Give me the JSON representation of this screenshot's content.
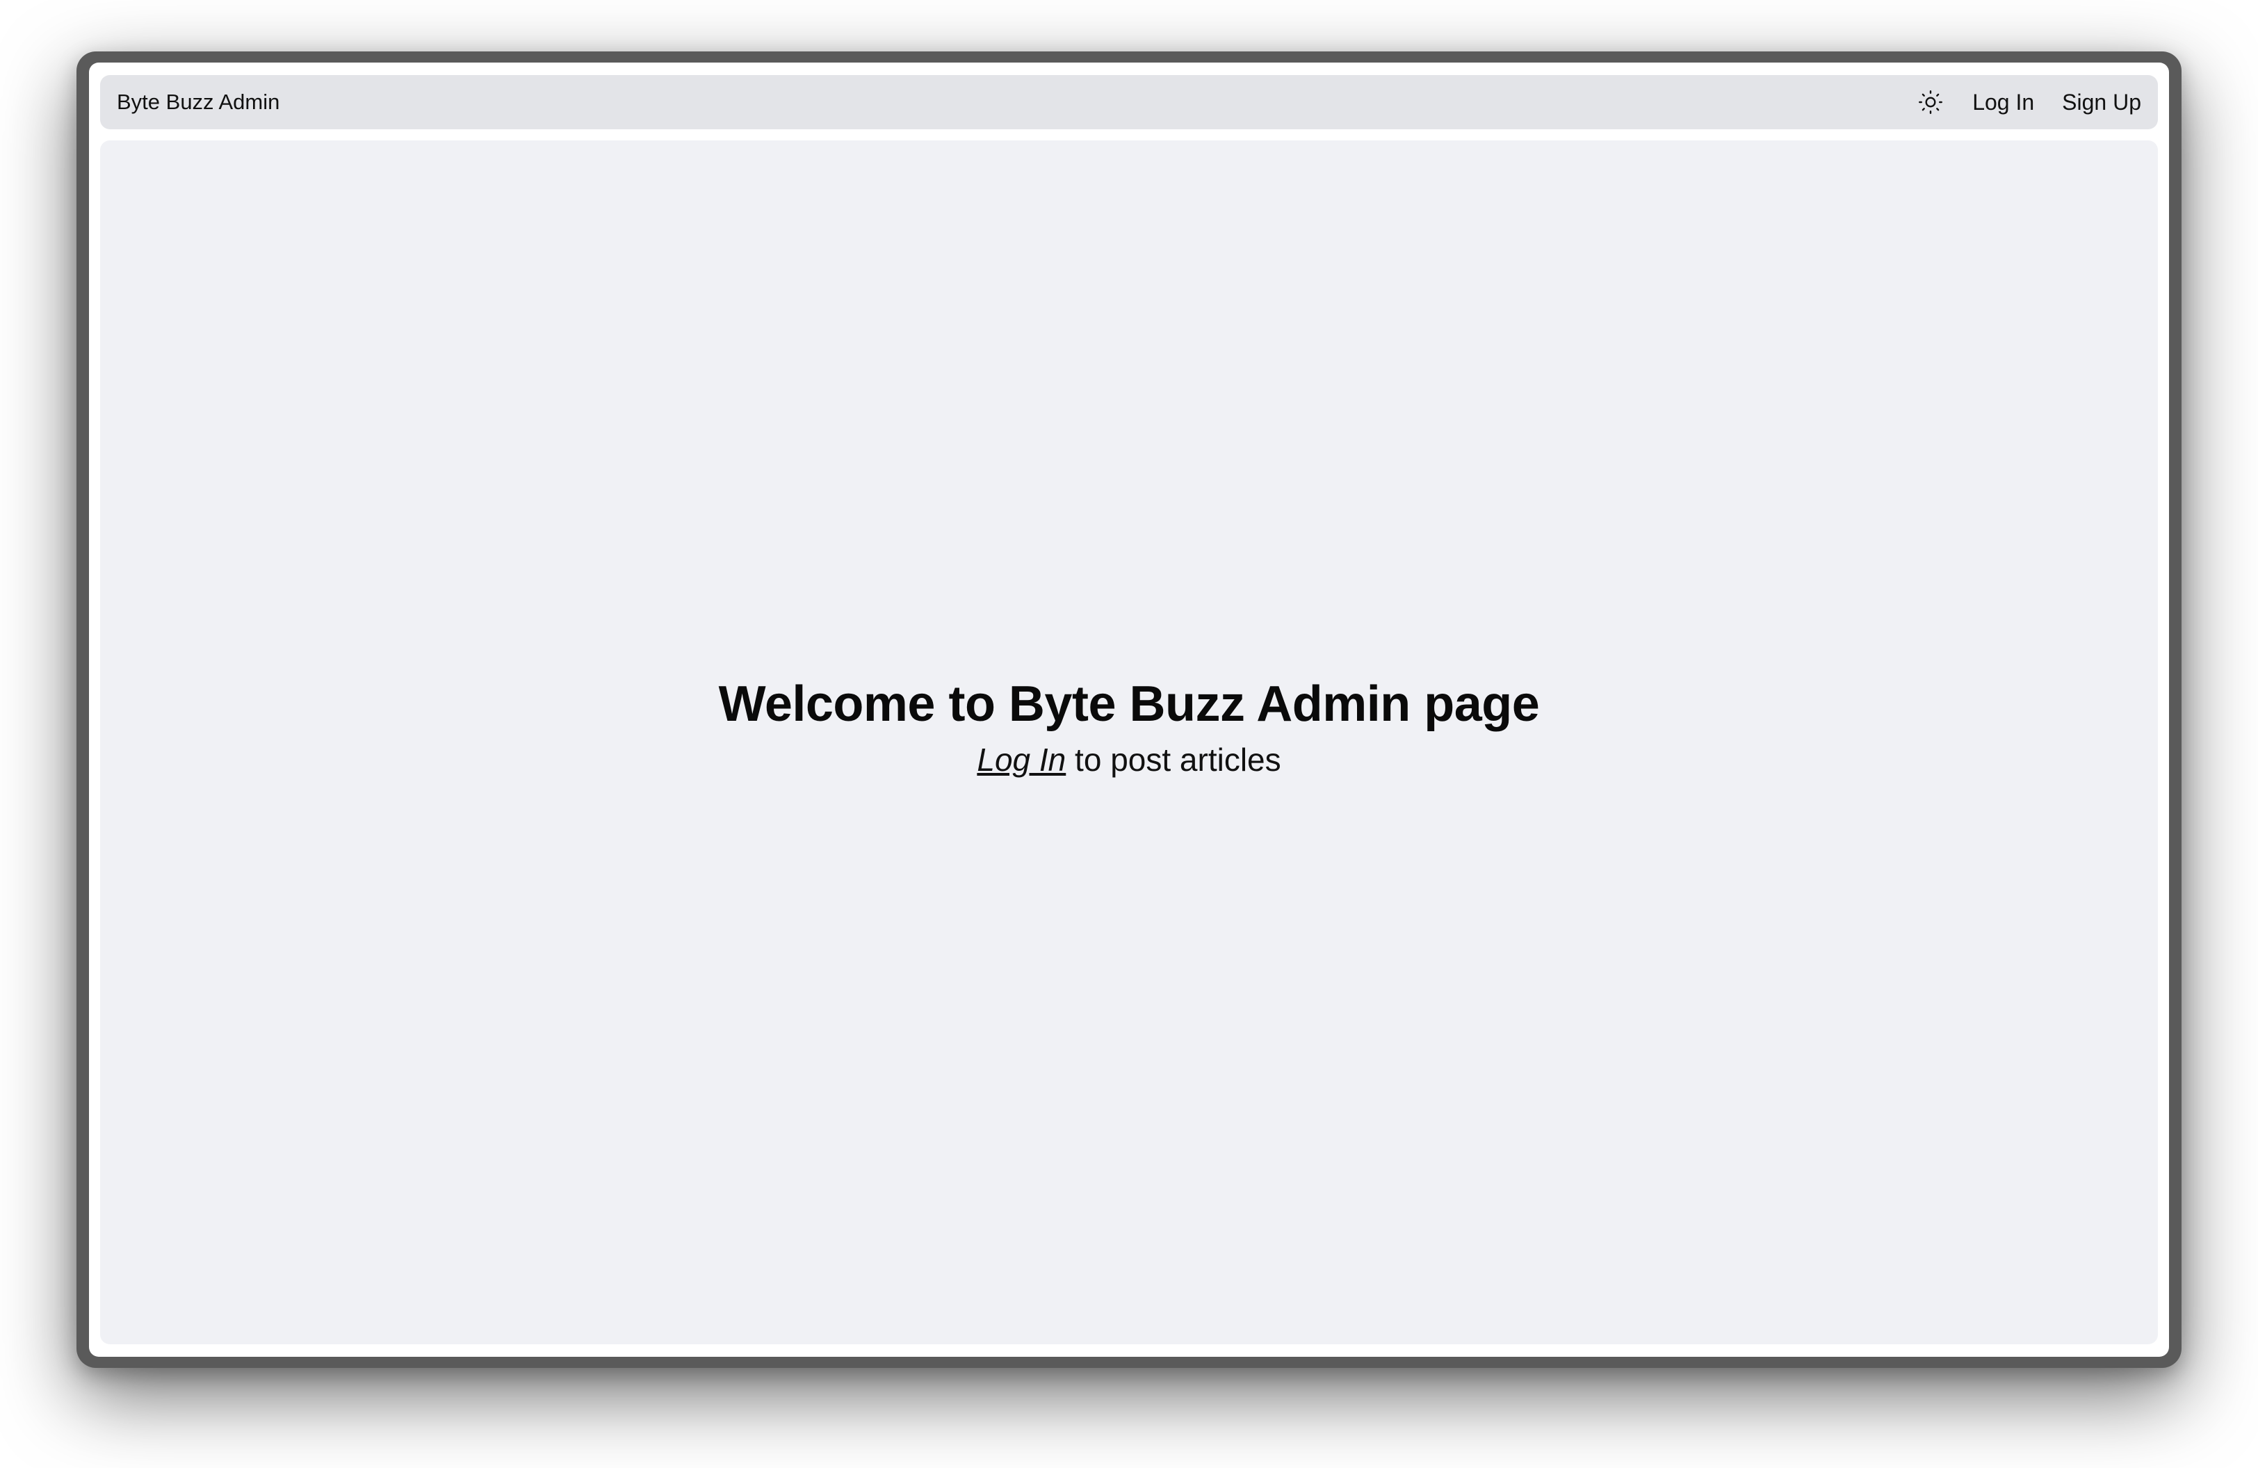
{
  "navbar": {
    "brand": "Byte Buzz Admin",
    "theme_icon": "sun-icon",
    "login_label": "Log In",
    "signup_label": "Sign Up"
  },
  "main": {
    "title": "Welcome to Byte Buzz Admin page",
    "subtitle_link": "Log In",
    "subtitle_rest": " to post articles"
  },
  "colors": {
    "navbar_bg": "#e3e4e8",
    "main_bg": "#f0f1f5",
    "text": "#111111",
    "frame": "#5a5a5a"
  }
}
